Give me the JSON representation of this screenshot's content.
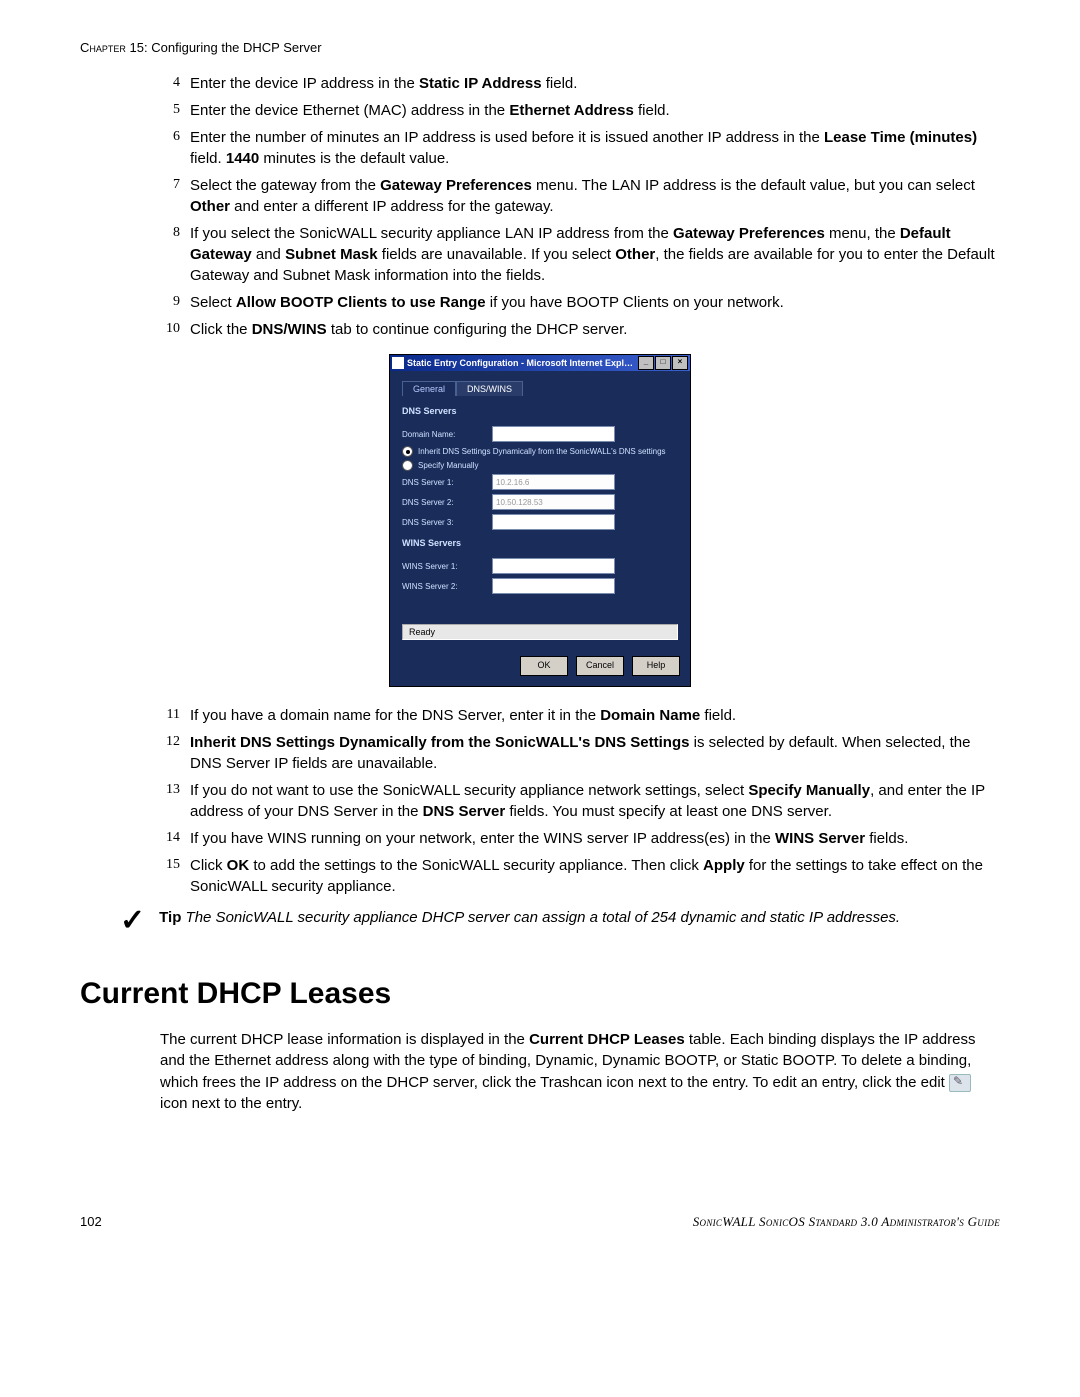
{
  "header": {
    "chapter_prefix": "Chapter",
    "chapter_num": "15:",
    "chapter_title": "Configuring the DHCP Server"
  },
  "steps_a": [
    {
      "n": "4",
      "parts": [
        "Enter the device IP address in the ",
        {
          "b": "Static IP Address"
        },
        " field."
      ]
    },
    {
      "n": "5",
      "parts": [
        "Enter the device Ethernet (MAC) address in the ",
        {
          "b": "Ethernet Address"
        },
        " field."
      ]
    },
    {
      "n": "6",
      "parts": [
        "Enter the number of minutes an IP address is used before it is issued another IP address in the ",
        {
          "b": "Lease Time (minutes)"
        },
        " field. ",
        {
          "b": "1440"
        },
        " minutes is the default value."
      ]
    },
    {
      "n": "7",
      "parts": [
        "Select the gateway from the ",
        {
          "b": "Gateway Preferences"
        },
        " menu. The LAN IP address is the default value, but you can select ",
        {
          "b": "Other"
        },
        " and enter a different IP address for the gateway."
      ]
    },
    {
      "n": "8",
      "parts": [
        "If you select the SonicWALL security appliance LAN IP address from the ",
        {
          "b": "Gateway Preferences"
        },
        " menu, the ",
        {
          "b": "Default Gateway"
        },
        " and ",
        {
          "b": "Subnet Mask"
        },
        " fields are unavailable. If you select ",
        {
          "b": "Other"
        },
        ", the fields are available for you to enter the Default Gateway and Subnet Mask information into the fields."
      ]
    },
    {
      "n": "9",
      "parts": [
        "Select ",
        {
          "b": "Allow BOOTP Clients to use Range"
        },
        " if you have BOOTP Clients on your network."
      ]
    },
    {
      "n": "10",
      "parts": [
        "Click the ",
        {
          "b": "DNS/WINS"
        },
        " tab to continue configuring the DHCP server."
      ]
    }
  ],
  "dialog": {
    "title": "Static Entry Configuration - Microsoft Internet Explorer provided by SonicWALL, I...",
    "tabs": {
      "general": "General",
      "dnswins": "DNS/WINS"
    },
    "dns_hdr": "DNS Servers",
    "domain_label": "Domain Name:",
    "domain_value": "",
    "radio_inherit": "Inherit DNS Settings Dynamically from the SonicWALL's DNS settings",
    "radio_manual": "Specify Manually",
    "dns1_label": "DNS Server 1:",
    "dns1_value": "10.2.16.6",
    "dns2_label": "DNS Server 2:",
    "dns2_value": "10.50.128.53",
    "dns3_label": "DNS Server 3:",
    "dns3_value": "",
    "wins_hdr": "WINS Servers",
    "wins1_label": "WINS Server 1:",
    "wins1_value": "",
    "wins2_label": "WINS Server 2:",
    "wins2_value": "",
    "status": "Ready",
    "btn_ok": "OK",
    "btn_cancel": "Cancel",
    "btn_help": "Help"
  },
  "steps_b": [
    {
      "n": "11",
      "parts": [
        "If you have a domain name for the DNS Server, enter it in the ",
        {
          "b": "Domain Name"
        },
        " field."
      ]
    },
    {
      "n": "12",
      "parts": [
        {
          "b": "Inherit DNS Settings Dynamically from the SonicWALL's DNS Settings"
        },
        " is selected by default. When selected, the DNS Server IP fields are unavailable."
      ]
    },
    {
      "n": "13",
      "parts": [
        "If you do not want to use the SonicWALL security appliance network settings, select ",
        {
          "b": "Specify Manually"
        },
        ", and enter the IP address of your DNS Server in the ",
        {
          "b": "DNS Server"
        },
        " fields. You must specify at least one DNS server."
      ]
    },
    {
      "n": "14",
      "parts": [
        "If you have WINS running on your network, enter the WINS server IP address(es) in the ",
        {
          "b": "WINS Server"
        },
        " fields."
      ]
    },
    {
      "n": "15",
      "parts": [
        "Click ",
        {
          "b": "OK"
        },
        " to add the settings to the SonicWALL security appliance. Then click ",
        {
          "b": "Apply"
        },
        " for the settings to take effect on the SonicWALL security appliance."
      ]
    }
  ],
  "tip": {
    "label": "Tip",
    "text": "The SonicWALL security appliance DHCP server can assign a total of 254 dynamic and static IP addresses."
  },
  "heading": "Current DHCP Leases",
  "paragraph": {
    "pre": "The current DHCP lease information is displayed in the ",
    "bold": "Current DHCP Leases",
    "post": " table. Each binding displays the IP address and the Ethernet address along with the type of binding, Dynamic, Dynamic BOOTP, or Static BOOTP. To delete a binding, which frees the IP address on the DHCP server, click the Trashcan icon next to the entry. To edit an entry, click the edit ",
    "after_icon": " icon next to the entry."
  },
  "footer": {
    "page": "102",
    "guide": "SonicWALL SonicOS Standard 3.0 Administrator's Guide"
  }
}
